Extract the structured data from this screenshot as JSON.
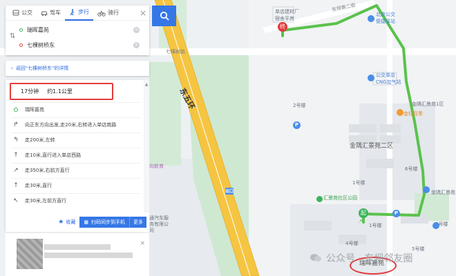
{
  "modes": [
    {
      "label": "公交",
      "icon": "bus-icon"
    },
    {
      "label": "驾车",
      "icon": "car-icon"
    },
    {
      "label": "步行",
      "icon": "walk-icon",
      "active": true
    },
    {
      "label": "骑行",
      "icon": "bike-icon"
    }
  ],
  "route": {
    "from": "瑞晖嘉苑",
    "to": "七棵树桥东"
  },
  "back_link": "返回\"七棵树桥东\"的详情",
  "summary": {
    "time": "17分钟",
    "distance": "约1.1公里"
  },
  "steps": [
    {
      "icon": "start",
      "text": "瑞晖嘉苑"
    },
    {
      "icon": "turn-right",
      "text": "向正东方向出发,走20米,右转进入单店南路"
    },
    {
      "icon": "turn-left",
      "text": "走200米,左转"
    },
    {
      "icon": "straight",
      "text": "走10米,直行进入单店西路"
    },
    {
      "icon": "straight-right",
      "text": "走350米,右前方直行"
    },
    {
      "icon": "straight",
      "text": "走30米,直行"
    },
    {
      "icon": "straight-left",
      "text": "走30米,左前方直行"
    }
  ],
  "actions": {
    "favorite": "收藏",
    "send_to_phone": "扫码同步到手机",
    "more": "更多"
  },
  "map": {
    "labels": {
      "expressway": "东五环",
      "road_north": "东坝南二街",
      "qikeshu_road": "七棵树路",
      "store_name": "单店建材厂",
      "store_sub": "宿舍平房",
      "bus_station": "北京公交",
      "bus_station_sub": "便捷驿站",
      "gas_station": "公交单店",
      "gas_station_sub": "CNG加气站",
      "huiheng1": "金隅汇景苑1区",
      "restaurant": "金钰百季",
      "huiheng2": "金隅汇景苑二区",
      "bldg2": "2号楼",
      "bldg1": "1号楼",
      "bldg6": "6号楼",
      "bldg4": "4号楼",
      "bldg5": "5号楼",
      "bldg7": "7号楼",
      "bldg_1b": "1号楼",
      "park": "汇景苑社区公园",
      "huiheng3": "金隅汇景苑",
      "yard": "通汽车服务有限公司",
      "school": "向新育",
      "yuanhe": "瑞晖嘉苑",
      "start_marker": "起",
      "end_marker": "终",
      "exit": "出口"
    },
    "route_color": "#5ac24b",
    "expressway_color": "#f5c542"
  },
  "watermark": "公众号 · 东坝邻友圈"
}
